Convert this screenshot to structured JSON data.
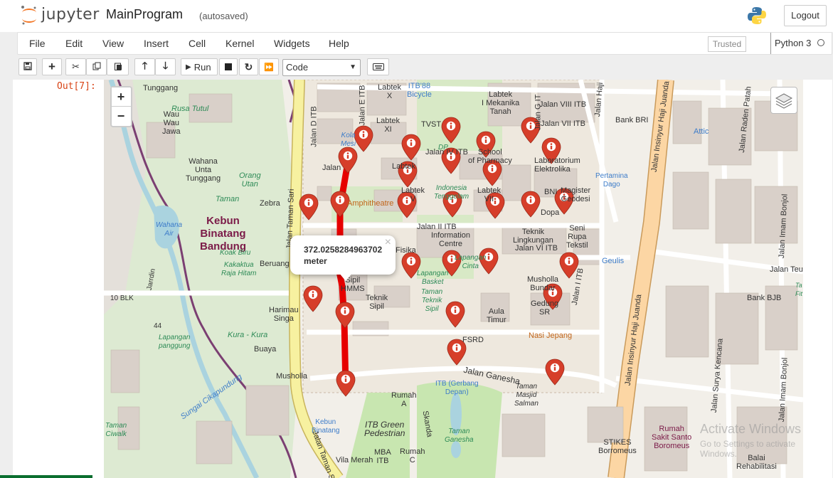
{
  "header": {
    "logo_text": "jupyter",
    "notebook_name": "MainProgram",
    "autosave": "(autosaved)",
    "logout_label": "Logout"
  },
  "menubar": {
    "items": [
      "File",
      "Edit",
      "View",
      "Insert",
      "Cell",
      "Kernel",
      "Widgets",
      "Help"
    ],
    "trusted": "Trusted",
    "kernel": "Python 3"
  },
  "toolbar": {
    "run_label": "Run",
    "cell_type": "Code",
    "icons": [
      "save-icon",
      "add-cell-icon",
      "cut-icon",
      "copy-icon",
      "paste-icon",
      "move-up-icon",
      "move-down-icon",
      "run-icon",
      "stop-icon",
      "restart-icon",
      "fast-forward-icon",
      "keyboard-icon"
    ]
  },
  "output": {
    "prompt": "Out[7]:"
  },
  "map": {
    "zoom_in": "+",
    "zoom_out": "−",
    "popup_text": "372.0258284963702 meter",
    "popup_close": "×",
    "route_color": "#e60000",
    "marker_color": "#d63e2a",
    "labels": {
      "tunggang": "Tunggang",
      "rusa_tutul": "Rusa Tutul",
      "wau": "Wau\nWau\nJawa",
      "wahana": "Wahana\nUnta\nTunggang",
      "orang_utan": "Orang\nUtan",
      "taman": "Taman",
      "zebra": "Zebra",
      "kebun": "Kebun\nBinatang\nBandung",
      "wahana_air": "Wahana\nAir",
      "koak_biru": "Koak Biru",
      "kakaktua": "Kakaktua\nRaja Hitam",
      "beruang": "Beruang",
      "blk10": "10 BLK",
      "harimau": "Harimau\nSinga",
      "jl44": "44",
      "kura": "Kura - Kura",
      "lapangan_panggung": "Lapangan\npanggung",
      "buaya": "Buaya",
      "musholla": "Musholla",
      "sungai": "Sungai Cikapundung",
      "taman_ciwalk": "Taman\nCiwalk",
      "jarrdin": "Jarrdin",
      "jalan_d": "Jalan D ITB",
      "jalan_e": "Jalan E ITB",
      "labtek_x": "Labtek\nX",
      "itb88": "ITB'88\nBicycle",
      "labtek_xi": "Labtek\nXI",
      "tvst": "TVST",
      "kola": "Kola\nMesi",
      "labtek_mek": "Labtek\nI Mekanika\nTanah",
      "jalan_viii": "Jalan VIII ITB",
      "jalan_vii": "Jalan VII ITB",
      "jalan_g": "Jalan G IT",
      "jalan_iv": "Jalan IV ITB",
      "school": "School\nof Pharmacy",
      "labtek": "Labtek",
      "laboratorium": "Laboratorium\nElektrolika",
      "jalan": "Jalan",
      "dp": "DP",
      "indonesia": "Indonesia\nTenggelam",
      "labtek_vii": "Labtek\nVII",
      "bni": "BNI",
      "magister": "Magister\nGeodesi",
      "amphitheatre": "Amphitheatre",
      "labtek_v": "Labtek\nV",
      "jalan_ii": "Jalan II ITB",
      "dopa": "Dopa",
      "information": "Information\nCentre",
      "teknik_lingk": "Teknik\nLingkungan",
      "seni_rupa": "Seni\nRupa\nTekstil",
      "jalan_vi": "Jalan VI ITB",
      "fisika": "Fisika",
      "lapangan_cinta": "Lapangan\nCinta",
      "lapangan_basket": "Lapangan\nBasket",
      "taman_teknik": "Taman\nTeknik\nSipil",
      "musholla_bundar": "Musholla\nBundar",
      "teknik_sipil": "Teknik\nSipil",
      "sipil_hmms": "Sipil\nHMMS",
      "aula_timur": "Aula\nTimur",
      "gedung_sr": "Gedung\nSR",
      "jalan_i": "Jalan I ITB",
      "nasi_jepang": "Nasi Jepang",
      "fsrd": "FSRD",
      "jalan_ganesha": "Jalan Ganesha",
      "itb_gerbang": "ITB (Gerbang\nDepan)",
      "taman_masjid": "Taman\nMasjid\nSalman",
      "rumah_a": "Rumah\nA",
      "skanda": "Skanda",
      "kebun_binatang": "Kebun\nBinatang",
      "itb_green": "ITB Green\nPedestrian",
      "taman_ganesha": "Taman\nGanesha",
      "mba_itb": "MBA\nITB",
      "rumah_c": "Rumah\nC",
      "vila_merah": "Vila Merah",
      "stikes": "STIKES\nBorromeus",
      "jalan_taman_sari": "Jalan Taman Sari",
      "jalan_taman_sari2": "Jalan Taman Sa",
      "jalan_haji": "Jalan Haji",
      "jalan_insinyur": "Jalan Insinyur Haji Juanda",
      "jalan_insinyur2": "Jalan Insinyur Haji Juanda",
      "bank_bri": "Bank BRI",
      "attic": "Attic",
      "pertamina": "Pertamina\nDago",
      "geulis": "Geulis",
      "bank_bjb": "Bank BJB",
      "jalan_raden": "Jalan Raden Patah",
      "jalan_imam": "Jalan Imam Bonjol",
      "jalan_imam2": "Jalan Imam Bonjol",
      "jalan_teuku": "Jalan Teuk",
      "jalan_surya": "Jalan Surya Kencana",
      "rumah_sakit": "Rumah\nSakit Santo\nBoromeus",
      "balai": "Balai\nRehabilitasi",
      "jalan_sawah": "Jalan S",
      "ta": "Ta\nFit"
    }
  },
  "watermark": {
    "line1": "Activate Windows",
    "line2": "Go to Settings to activate Windows."
  }
}
